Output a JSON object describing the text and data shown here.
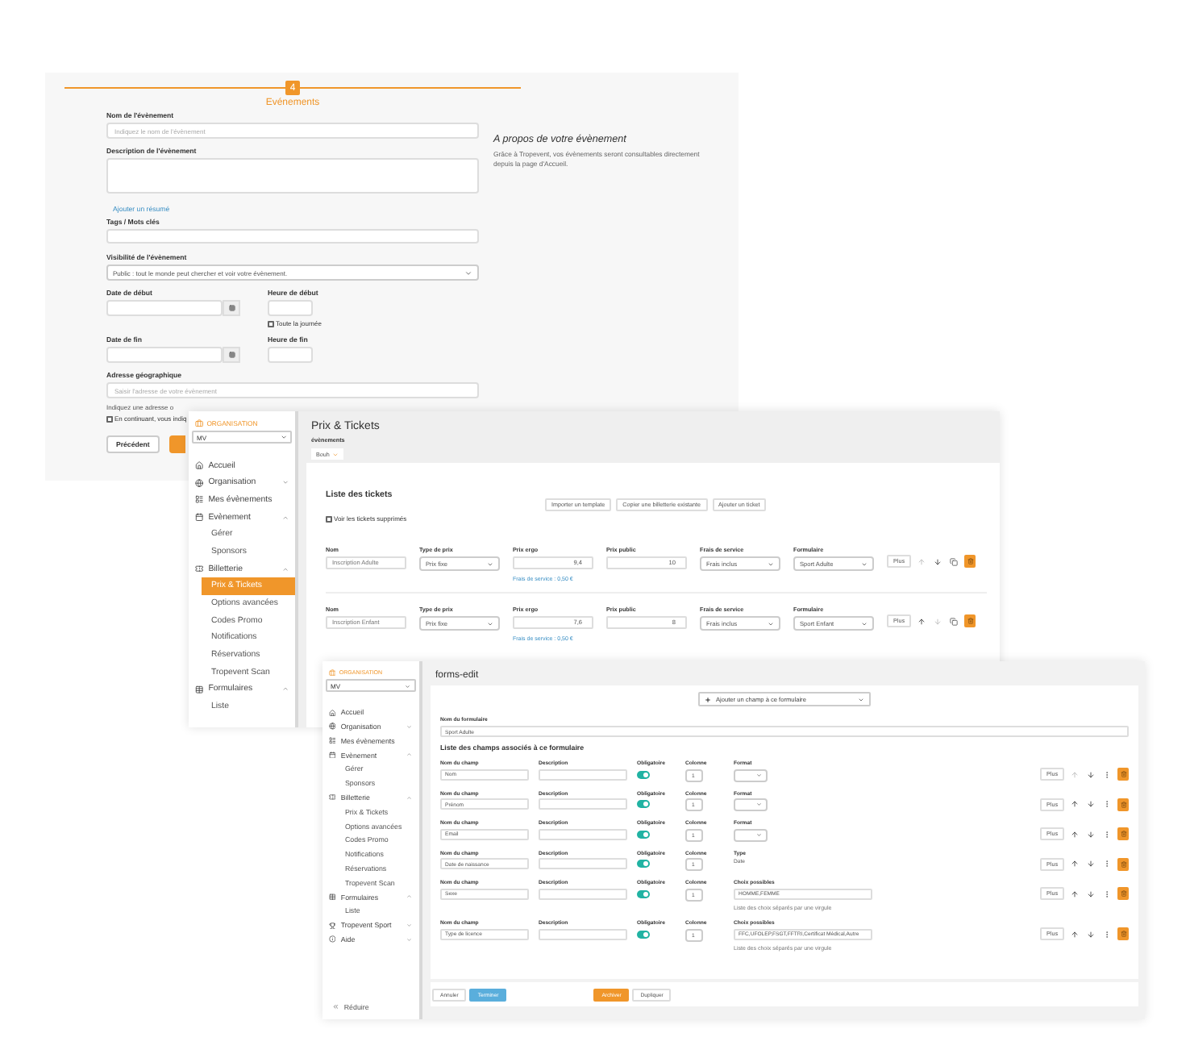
{
  "event_form": {
    "step": "4",
    "title": "Evénements",
    "name": {
      "label": "Nom de l'évènement",
      "placeholder": "Indiquez le nom de l'évènement"
    },
    "description": {
      "label": "Description de l'évènement"
    },
    "summary_link": "Ajouter un résumé",
    "tags": {
      "label": "Tags / Mots clés"
    },
    "visibility": {
      "label": "Visibilité de l'évènement",
      "value": "Public : tout le monde peut chercher et voir votre évènement."
    },
    "start_date": {
      "label": "Date de début"
    },
    "start_time": {
      "label": "Heure de début"
    },
    "all_day": {
      "label": "Toute la journée",
      "checked": false
    },
    "end_date": {
      "label": "Date de fin"
    },
    "end_time": {
      "label": "Heure de fin"
    },
    "address": {
      "label": "Adresse géographique",
      "placeholder": "Saisir l'adresse de votre évènement"
    },
    "address_hint": "Indiquez une adresse o",
    "consent": {
      "label": "En continuant, vous indiq",
      "checked": false
    },
    "back_button": "Précédent",
    "aside": {
      "title": "A propos de votre évènement",
      "text": "Grâce à Tropevent, vos évènements seront consultables directement depuis la page d'Accueil."
    }
  },
  "tickets_window": {
    "sidebar": {
      "section": "ORGANISATION",
      "org": "MV",
      "items": [
        {
          "kind": "home",
          "label": "Accueil"
        },
        {
          "kind": "org",
          "label": "Organisation",
          "expanded": false
        },
        {
          "kind": "events",
          "label": "Mes évènements"
        },
        {
          "kind": "event",
          "label": "Evènement",
          "expanded": true,
          "children": [
            {
              "label": "Gérer",
              "selected": false
            },
            {
              "label": "Sponsors",
              "selected": false
            }
          ]
        },
        {
          "kind": "ticketing",
          "label": "Billetterie",
          "expanded": true,
          "children": [
            {
              "label": "Prix & Tickets",
              "selected": true
            },
            {
              "label": "Options avancées",
              "selected": false
            },
            {
              "label": "Codes Promo",
              "selected": false
            },
            {
              "label": "Notifications",
              "selected": false
            },
            {
              "label": "Réservations",
              "selected": false
            },
            {
              "label": "Tropevent Scan",
              "selected": false
            }
          ]
        },
        {
          "kind": "forms",
          "label": "Formulaires",
          "expanded": true,
          "children": [
            {
              "label": "Liste",
              "selected": false
            }
          ]
        }
      ]
    },
    "title": "Prix & Tickets",
    "event_label": "évènements",
    "event_value": "Bouh",
    "list_title": "Liste des tickets",
    "actions": [
      "Importer un template",
      "Copier une billetterie existante",
      "Ajouter un ticket"
    ],
    "show_deleted": {
      "label": "Voir les tickets supprimés",
      "checked": false
    },
    "tickets": [
      {
        "fields": [
          {
            "kind": "text",
            "label": "Nom",
            "value": "Inscription Adulte"
          },
          {
            "kind": "select",
            "label": "Type de prix",
            "value": "Prix fixe"
          },
          {
            "kind": "number",
            "label": "Prix ergo",
            "value": "9,4",
            "note": "Frais de service : 0,50 €"
          },
          {
            "kind": "number",
            "label": "Prix public",
            "value": "10"
          },
          {
            "kind": "select",
            "label": "Frais de service",
            "value": "Frais inclus"
          },
          {
            "kind": "select",
            "label": "Formulaire",
            "value": "Sport Adulte"
          }
        ],
        "more": "Plus",
        "can_move_up": false,
        "can_move_down": true
      },
      {
        "fields": [
          {
            "kind": "text",
            "label": "Nom",
            "value": "Inscription Enfant"
          },
          {
            "kind": "select",
            "label": "Type de prix",
            "value": "Prix fixe"
          },
          {
            "kind": "number",
            "label": "Prix ergo",
            "value": "7,6",
            "note": "Frais de service : 0,50 €"
          },
          {
            "kind": "number",
            "label": "Prix public",
            "value": "8"
          },
          {
            "kind": "select",
            "label": "Frais de service",
            "value": "Frais inclus"
          },
          {
            "kind": "select",
            "label": "Formulaire",
            "value": "Sport Enfant"
          }
        ],
        "more": "Plus",
        "can_move_up": true,
        "can_move_down": false
      }
    ]
  },
  "form_window": {
    "sidebar": {
      "section": "ORGANISATION",
      "org": "MV",
      "items": [
        {
          "kind": "home",
          "label": "Accueil"
        },
        {
          "kind": "org",
          "label": "Organisation",
          "expanded": false
        },
        {
          "kind": "events",
          "label": "Mes évènements"
        },
        {
          "kind": "event",
          "label": "Evènement",
          "expanded": true,
          "children": [
            {
              "label": "Gérer",
              "selected": false
            },
            {
              "label": "Sponsors",
              "selected": false
            }
          ]
        },
        {
          "kind": "ticketing",
          "label": "Billetterie",
          "expanded": true,
          "children": [
            {
              "label": "Prix & Tickets",
              "selected": false
            },
            {
              "label": "Options avancées",
              "selected": false
            },
            {
              "label": "Codes Promo",
              "selected": false
            },
            {
              "label": "Notifications",
              "selected": false
            },
            {
              "label": "Réservations",
              "selected": false
            },
            {
              "label": "Tropevent Scan",
              "selected": false
            }
          ]
        },
        {
          "kind": "forms",
          "label": "Formulaires",
          "expanded": true,
          "children": [
            {
              "label": "Liste",
              "selected": false
            }
          ]
        },
        {
          "kind": "sport",
          "label": "Tropevent Sport",
          "expanded": false
        },
        {
          "kind": "help",
          "label": "Aide",
          "expanded": false
        }
      ],
      "collapse": "Réduire"
    },
    "title": "forms-edit",
    "add_field": "Ajouter un champ à ce formulaire",
    "name_label": "Nom du formulaire",
    "name_value": "Sport Adulte",
    "list_title": "Liste des champs associés à ce formulaire",
    "fields": [
      {
        "name_label": "Nom du champ",
        "name": "Nom",
        "description_label": "Description",
        "required_label": "Obligatoire",
        "required": true,
        "column_label": "Colonne",
        "column": "1",
        "extra": {
          "kind": "select",
          "label": "Format"
        },
        "more": "Plus",
        "can_move_up": false,
        "can_move_down": true
      },
      {
        "name_label": "Nom du champ",
        "name": "Prénom",
        "description_label": "Description",
        "required_label": "Obligatoire",
        "required": true,
        "column_label": "Colonne",
        "column": "1",
        "extra": {
          "kind": "select",
          "label": "Format"
        },
        "more": "Plus",
        "can_move_up": true,
        "can_move_down": true
      },
      {
        "name_label": "Nom du champ",
        "name": "Email",
        "description_label": "Description",
        "required_label": "Obligatoire",
        "required": true,
        "column_label": "Colonne",
        "column": "1",
        "extra": {
          "kind": "select",
          "label": "Format"
        },
        "more": "Plus",
        "can_move_up": true,
        "can_move_down": true
      },
      {
        "name_label": "Nom du champ",
        "name": "Date de naissance",
        "description_label": "Description",
        "required_label": "Obligatoire",
        "required": true,
        "column_label": "Colonne",
        "column": "1",
        "extra": {
          "kind": "text",
          "label": "Type",
          "value": "Date"
        },
        "more": "Plus",
        "can_move_up": true,
        "can_move_down": true
      },
      {
        "name_label": "Nom du champ",
        "name": "Sexe",
        "description_label": "Description",
        "required_label": "Obligatoire",
        "required": true,
        "column_label": "Colonne",
        "column": "1",
        "extra": {
          "kind": "choices",
          "label": "Choix possibles",
          "value": "HOMME,FEMME",
          "hint": "Liste des choix séparés par une virgule"
        },
        "more": "Plus",
        "can_move_up": true,
        "can_move_down": true
      },
      {
        "name_label": "Nom du champ",
        "name": "Type de licence",
        "description_label": "Description",
        "required_label": "Obligatoire",
        "required": true,
        "column_label": "Colonne",
        "column": "1",
        "extra": {
          "kind": "choices",
          "label": "Choix possibles",
          "value": "FFC,UFOLEP,FSGT,FFTRI,Certificat Médical,Autre",
          "hint": "Liste des choix séparés par une virgule"
        },
        "more": "Plus",
        "can_move_up": true,
        "can_move_down": true
      }
    ],
    "footer": [
      {
        "kind": "plain",
        "label": "Annuler"
      },
      {
        "kind": "primary",
        "label": "Terminer"
      },
      {
        "kind": "spacer"
      },
      {
        "kind": "warning",
        "label": "Archiver"
      },
      {
        "kind": "plain",
        "label": "Dupliquer"
      }
    ]
  }
}
